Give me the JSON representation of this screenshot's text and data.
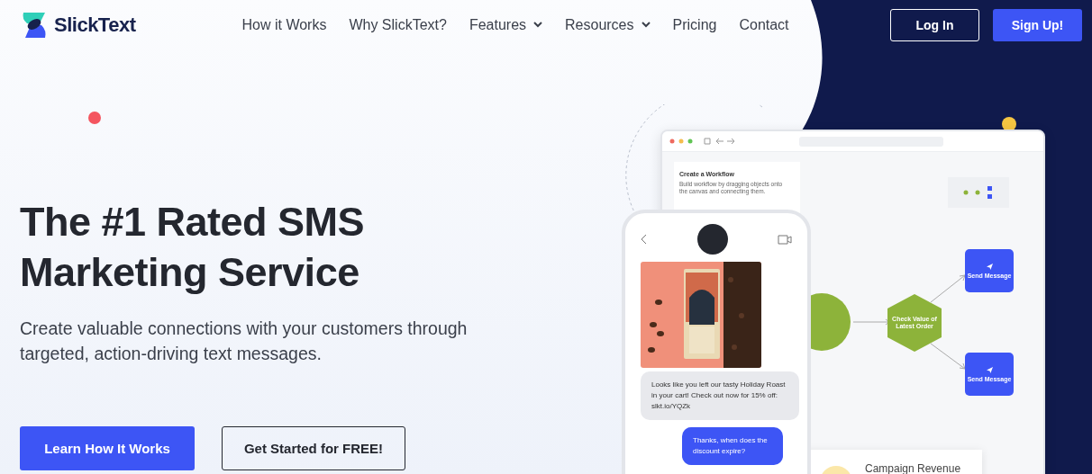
{
  "brand": {
    "name": "SlickText"
  },
  "nav": [
    {
      "label": "How it Works",
      "dropdown": false
    },
    {
      "label": "Why SlickText?",
      "dropdown": false
    },
    {
      "label": "Features",
      "dropdown": true
    },
    {
      "label": "Resources",
      "dropdown": true
    },
    {
      "label": "Pricing",
      "dropdown": false
    },
    {
      "label": "Contact",
      "dropdown": false
    }
  ],
  "auth": [
    {
      "label": "Log In",
      "kind": "outline"
    },
    {
      "label": "Sign Up!",
      "kind": "primary"
    }
  ],
  "hero": {
    "title_lines": [
      "The #1 Rated SMS",
      "Marketing Service"
    ],
    "subtitle": "Create valuable connections with your customers through targeted, action-driving text messages.",
    "buttons": [
      {
        "label": "Learn How It Works",
        "kind": "primary"
      },
      {
        "label": "Get Started for FREE!",
        "kind": "outline"
      }
    ]
  },
  "workflow": {
    "panel": {
      "title": "Create a Workflow",
      "description": "Build workflow by dragging objects onto the canvas and connecting them."
    },
    "nodes": [
      {
        "kind": "trigger"
      },
      {
        "kind": "condition",
        "label": "Check Value of Latest Order"
      },
      {
        "kind": "action",
        "label": "Send Message"
      },
      {
        "kind": "action",
        "label": "Send Message"
      }
    ]
  },
  "phone": {
    "messages": [
      {
        "kind": "received",
        "text": "Looks like you left our tasty Holiday Roast in your cart! Check out now for 15% off: slkt.io/YQZk"
      },
      {
        "kind": "sent",
        "text": "Thanks, when does the discount expire?"
      }
    ]
  },
  "card": {
    "title": "Campaign Revenue"
  }
}
